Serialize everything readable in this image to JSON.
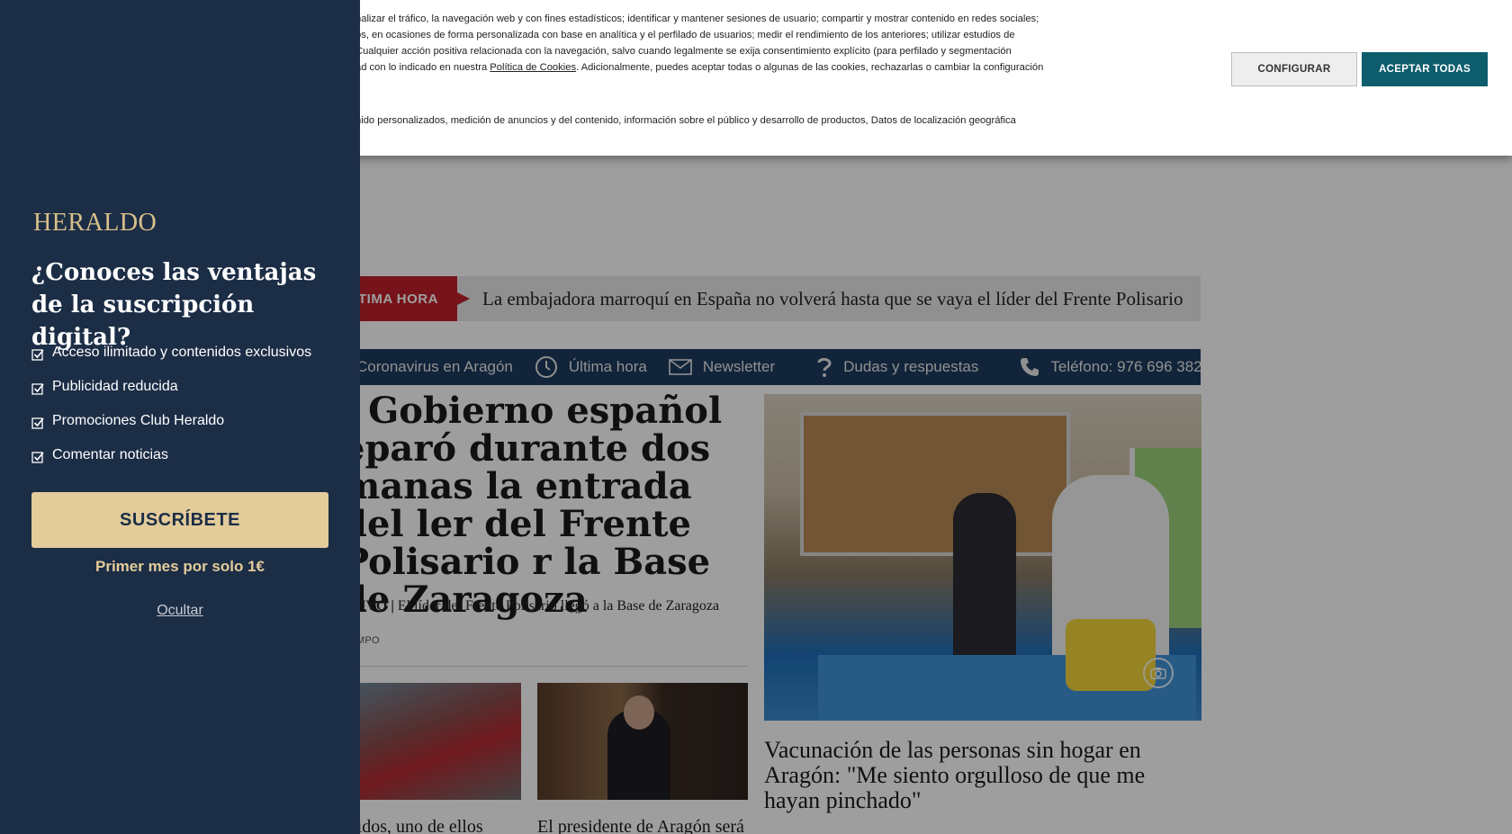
{
  "cookie_banner": {
    "lines": [
      "nalizar el tráfico, la navegación web y con fines estadísticos; identificar y mantener sesiones de usuario; compartir y mostrar contenido en redes sociales;",
      "os, en ocasiones de forma personalizada con base en analítica y el perfilado de usuarios; medir el rendimiento de los anteriores; utilizar estudios de",
      "Cualquier acción positiva relacionada con la navegación, salvo cuando legalmente se exija consentimiento explícito (para perfilado y segmentación"
    ],
    "line4_before": "ad con lo indicado en nuestra ",
    "policy_link": "Política de Cookies",
    "line4_after": ". Adicionalmente, puedes aceptar todas o algunas de las cookies, rechazarlas o cambiar la configuración",
    "purposes_line": "nido personalizados, medición de anuncios y del contenido, información sobre el público y desarrollo de productos, Datos de localización geográfica",
    "configure_label": "CONFIGURAR",
    "accept_label": "ACEPTAR TODAS",
    "accept_color": "#0d5d6d"
  },
  "subscription_panel": {
    "logo": "HERALDO",
    "title": "¿Conoces las ventajas de la suscripción digital?",
    "benefits": [
      "Acceso ilimitado y contenidos exclusivos",
      "Publicidad reducida",
      "Promociones Club Heraldo",
      "Comentar noticias"
    ],
    "subscribe_label": "SUSCRÍBETE",
    "promo_text": "Primer mes por solo 1€",
    "hide_label": "Ocultar",
    "panel_color": "#1c2d46",
    "accent_color": "#e3cc9a"
  },
  "breaking": {
    "label": "TIMA HORA",
    "text": "La embajadora marroquí en España no volverá hasta que se vaya el líder del Frente Polisario",
    "color": "#c0202a"
  },
  "nav": {
    "items": [
      {
        "label": "Coronavirus en Aragón",
        "icon": "none"
      },
      {
        "label": "Última hora",
        "icon": "clock-icon"
      },
      {
        "label": "Newsletter",
        "icon": "mail-icon"
      },
      {
        "label": "Dudas y respuestas",
        "icon": "question-icon"
      },
      {
        "label": "Teléfono: 976 696 382",
        "icon": "phone-icon"
      }
    ]
  },
  "main_story": {
    "headline": "l Gobierno español eparó durante dos manas la entrada del ler del Frente Polisario r la Base de Zaragoza",
    "kicker_label": "USIVO |",
    "kicker_text": " El líder del Frente Polisario llegó a la Base de Zaragoza",
    "byline": "CAMPO"
  },
  "teasers": [
    {
      "title": "ridos, uno de ellos"
    },
    {
      "title": "El presidente de Aragón será"
    }
  ],
  "photo_story": {
    "caption": "Vacunación de las personas sin hogar en Aragón: \"Me siento orgulloso de que me hayan pinchado\""
  }
}
